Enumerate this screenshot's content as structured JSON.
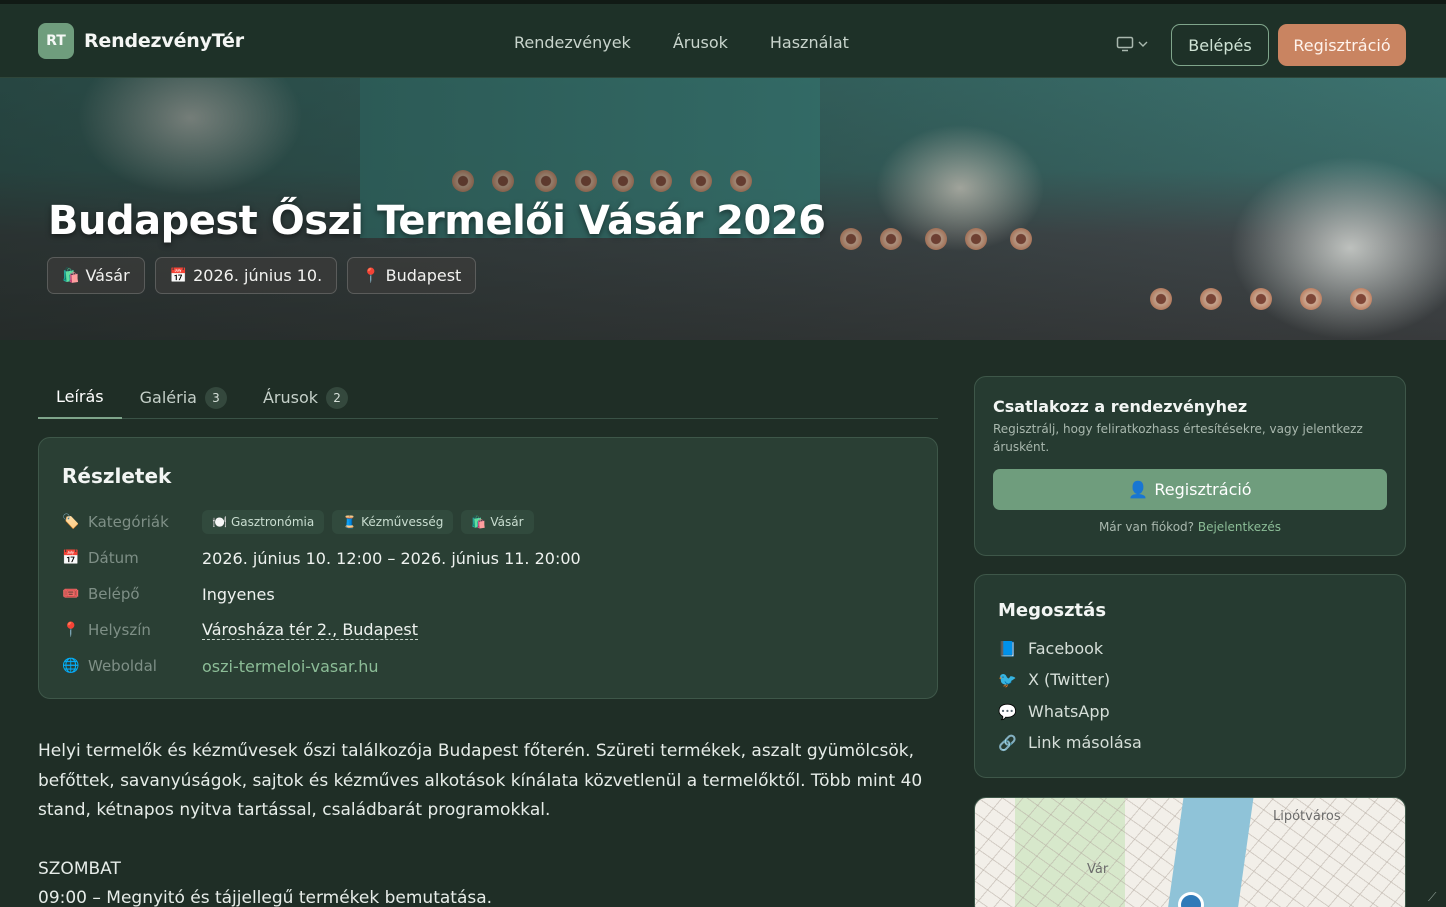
{
  "header": {
    "logo_badge": "RT",
    "logo_text": "RendezvényTér",
    "nav": [
      "Rendezvények",
      "Árusok",
      "Használat"
    ],
    "login_label": "Belépés",
    "register_label": "Regisztráció",
    "device_icon": "monitor-icon"
  },
  "hero": {
    "title": "Budapest Őszi Termelői Vásár 2026",
    "chips": [
      {
        "icon": "🛍️",
        "label": "Vásár"
      },
      {
        "icon": "📅",
        "label": "2026. június 10."
      },
      {
        "icon": "📍",
        "label": "Budapest"
      }
    ]
  },
  "tabs": [
    {
      "label": "Leírás",
      "count": ""
    },
    {
      "label": "Galéria",
      "count": "3"
    },
    {
      "label": "Árusok",
      "count": "2"
    }
  ],
  "details": {
    "title": "Részletek",
    "categories_label": "Kategóriák",
    "categories": [
      {
        "icon": "🍽️",
        "label": "Gasztronómia"
      },
      {
        "icon": "🧵",
        "label": "Kézművesség"
      },
      {
        "icon": "🛍️",
        "label": "Vásár"
      }
    ],
    "date_label": "Dátum",
    "date_value": "2026. június 10. 12:00 – 2026. június 11. 20:00",
    "entry_label": "Belépő",
    "entry_value": "Ingyenes",
    "location_label": "Helyszín",
    "location_value": "Városháza tér 2., Budapest",
    "website_label": "Weboldal",
    "website_value": "oszi-termeloi-vasar.hu"
  },
  "description": {
    "paragraph": "Helyi termelők és kézművesek őszi találkozója Budapest főterén. Szüreti termékek, aszalt gyümölcsök, befőttek, savanyúságok, sajtok és kézműves alkotások kínálata közvetlenül a termelőktől. Több mint 40 stand, kétnapos nyitva tartással, családbarát programokkal.",
    "day_heading": "SZOMBAT",
    "schedule_line": "09:00 – Megnyitó és tájjellegű termékek bemutatása."
  },
  "join": {
    "title": "Csatlakozz a rendezvényhez",
    "subtitle": "Regisztrálj, hogy feliratkozhass értesítésekre, vagy jelentkezz árusként.",
    "button_icon": "👤",
    "button_label": "Regisztráció",
    "footer_text": "Már van fiókod?",
    "footer_link": "Bejelentkezés"
  },
  "share": {
    "title": "Megosztás",
    "items": [
      {
        "icon": "📘",
        "label": "Facebook"
      },
      {
        "icon": "🐦",
        "label": "X (Twitter)"
      },
      {
        "icon": "💬",
        "label": "WhatsApp"
      },
      {
        "icon": "🔗",
        "label": "Link másolása"
      }
    ]
  },
  "map": {
    "label_1": "Lipótváros",
    "label_2": "Vár"
  }
}
